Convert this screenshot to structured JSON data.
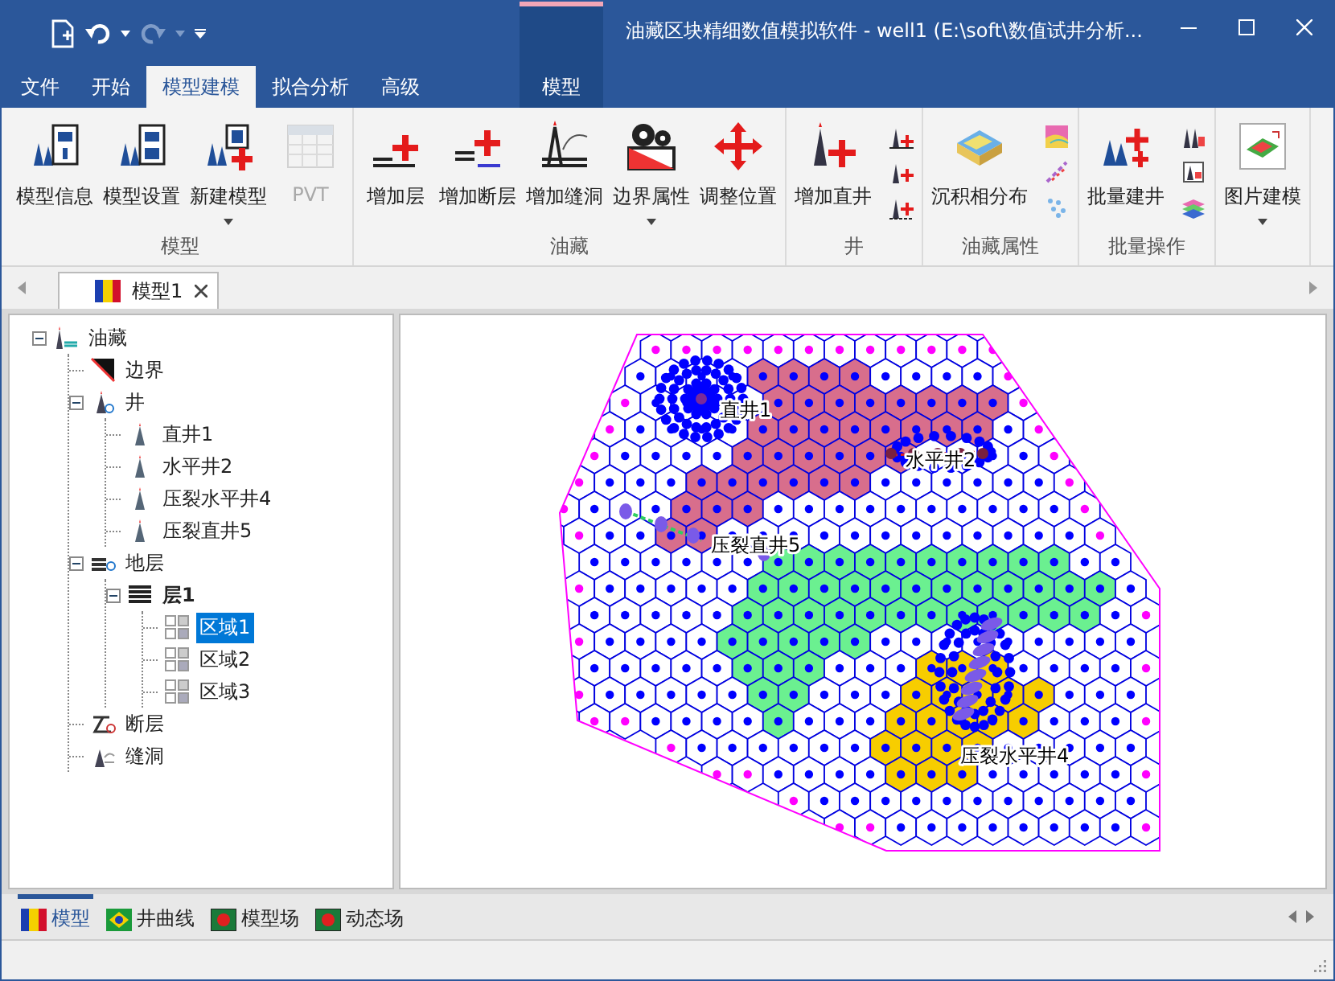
{
  "window": {
    "title": "油藏区块精细数值模拟软件 - well1 (E:\\soft\\数值试井分析..."
  },
  "ribbon_tabs": [
    {
      "label": "文件",
      "selected": false,
      "kind": "file"
    },
    {
      "label": "开始",
      "selected": false,
      "kind": "normal"
    },
    {
      "label": "模型建模",
      "selected": true,
      "kind": "normal"
    },
    {
      "label": "拟合分析",
      "selected": false,
      "kind": "normal"
    },
    {
      "label": "高级",
      "selected": false,
      "kind": "normal"
    },
    {
      "label": "模型",
      "selected": false,
      "kind": "contextual"
    }
  ],
  "ribbon_groups": [
    {
      "label": "模型",
      "buttons": [
        {
          "kind": "large",
          "label": "模型信息",
          "dropdown": false,
          "disabled": false
        },
        {
          "kind": "large",
          "label": "模型设置",
          "dropdown": false,
          "disabled": false
        },
        {
          "kind": "large",
          "label": "新建模型",
          "dropdown": true,
          "disabled": false
        },
        {
          "kind": "large",
          "label": "PVT",
          "dropdown": false,
          "disabled": true
        }
      ]
    },
    {
      "label": "油藏",
      "buttons": [
        {
          "kind": "large",
          "label": "增加层",
          "dropdown": false,
          "disabled": false
        },
        {
          "kind": "large",
          "label": "增加断层",
          "dropdown": false,
          "disabled": false
        },
        {
          "kind": "large",
          "label": "增加缝洞",
          "dropdown": false,
          "disabled": false
        },
        {
          "kind": "large",
          "label": "边界属性",
          "dropdown": true,
          "disabled": false
        },
        {
          "kind": "large",
          "label": "调整位置",
          "dropdown": false,
          "disabled": false
        }
      ]
    },
    {
      "label": "井",
      "buttons": [
        {
          "kind": "large",
          "label": "增加直井",
          "dropdown": false,
          "disabled": false
        },
        {
          "kind": "small"
        },
        {
          "kind": "small"
        },
        {
          "kind": "small"
        }
      ]
    },
    {
      "label": "油藏属性",
      "buttons": [
        {
          "kind": "large",
          "label": "沉积相分布",
          "dropdown": false,
          "disabled": false
        },
        {
          "kind": "small"
        },
        {
          "kind": "small"
        },
        {
          "kind": "small"
        }
      ]
    },
    {
      "label": "批量操作",
      "buttons": [
        {
          "kind": "large",
          "label": "批量建井",
          "dropdown": false,
          "disabled": false
        },
        {
          "kind": "small"
        },
        {
          "kind": "small"
        },
        {
          "kind": "small"
        }
      ]
    },
    {
      "buttons": [
        {
          "kind": "large",
          "label": "图片建模",
          "dropdown": true,
          "disabled": false
        }
      ]
    }
  ],
  "document_tab": {
    "label": "模型1"
  },
  "tree": [
    {
      "label": "油藏",
      "kind": "reservoir",
      "expanded": true,
      "selected": false,
      "bold": false,
      "children": [
        {
          "label": "边界",
          "kind": "boundary",
          "selected": false,
          "bold": false
        },
        {
          "label": "井",
          "kind": "wells",
          "expanded": true,
          "selected": false,
          "bold": false,
          "children": [
            {
              "label": "直井1",
              "kind": "well",
              "selected": false,
              "bold": false
            },
            {
              "label": "水平井2",
              "kind": "well",
              "selected": false,
              "bold": false
            },
            {
              "label": "压裂水平井4",
              "kind": "well",
              "selected": false,
              "bold": false
            },
            {
              "label": "压裂直井5",
              "kind": "well",
              "selected": false,
              "bold": false
            }
          ]
        },
        {
          "label": "地层",
          "kind": "strata",
          "expanded": true,
          "selected": false,
          "bold": false,
          "children": [
            {
              "label": "层1",
              "kind": "layer",
              "expanded": true,
              "selected": false,
              "bold": true,
              "children": [
                {
                  "label": "区域1",
                  "kind": "region",
                  "selected": true,
                  "bold": false
                },
                {
                  "label": "区域2",
                  "kind": "region",
                  "selected": false,
                  "bold": false
                },
                {
                  "label": "区域3",
                  "kind": "region",
                  "selected": false,
                  "bold": false
                }
              ]
            }
          ]
        },
        {
          "label": "断层",
          "kind": "fault",
          "selected": false,
          "bold": false
        },
        {
          "label": "缝洞",
          "kind": "cave",
          "selected": false,
          "bold": false
        }
      ]
    }
  ],
  "map": {
    "well_labels": [
      "直井1",
      "水平井2",
      "压裂直井5",
      "压裂水平井4"
    ]
  },
  "bottom_tabs": [
    {
      "label": "模型",
      "kind": "model",
      "selected": true
    },
    {
      "label": "井曲线",
      "kind": "curve",
      "selected": false
    },
    {
      "label": "模型场",
      "kind": "field",
      "selected": false
    },
    {
      "label": "动态场",
      "kind": "field",
      "selected": false
    }
  ]
}
